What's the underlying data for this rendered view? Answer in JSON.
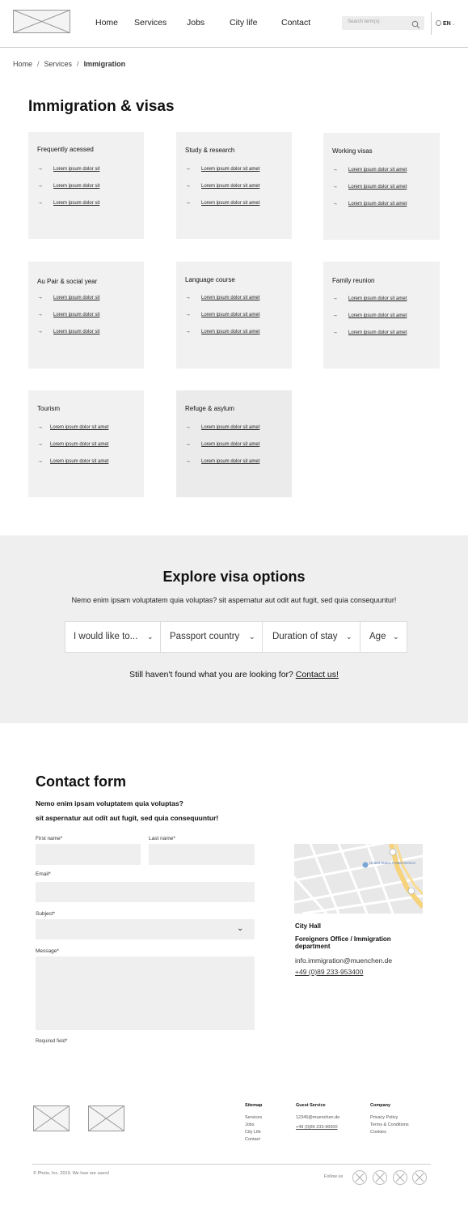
{
  "header": {
    "nav": [
      "Home",
      "Services",
      "Jobs",
      "City life",
      "Contact"
    ],
    "search_placeholder": "Search term(s)",
    "language": "EN"
  },
  "breadcrumb": {
    "home": "Home",
    "services": "Services",
    "current": "Immigration"
  },
  "page_title": "Immigration & visas",
  "cards": [
    {
      "title": "Frequently acessed",
      "links": [
        "Lorem ipsum dolor sit",
        "Lorem ipsum dolor sit",
        "Lorem ipsum dolor sit"
      ]
    },
    {
      "title": "Study & research",
      "links": [
        "Lorem ipsum dolor sit amet",
        "Lorem ipsum dolor sit amet",
        "Lorem ipsum dolor sit amet"
      ]
    },
    {
      "title": "Working visas",
      "links": [
        "Lorem ipsum dolor sit amet",
        "Lorem ipsum dolor sit amet",
        "Lorem ipsum dolor sit amet"
      ]
    },
    {
      "title": "Au Pair & social year",
      "links": [
        "Lorem ipsum dolor sit",
        "Lorem ipsum dolor sit",
        "Lorem ipsum dolor sit"
      ]
    },
    {
      "title": "Language course",
      "links": [
        "Lorem ipsum dolor sit amet",
        "Lorem ipsum dolor sit amet",
        "Lorem ipsum dolor sit amet"
      ]
    },
    {
      "title": "Family reunion",
      "links": [
        "Lorem ipsum dolor sit amet",
        "Lorem ipsum dolor sit amet",
        "Lorem ipsum dolor sit amet"
      ]
    },
    {
      "title": "Tourism",
      "links": [
        "Lorem ipsum dolor sit amet",
        "Lorem ipsum dolor sit amet",
        "Lorem ipsum dolor sit amet"
      ]
    },
    {
      "title": "Refuge & asylum",
      "links": [
        "Lorem ipsum dolor sit amet",
        "Lorem ipsum dolor sit amet",
        "Lorem ipsum dolor sit amet"
      ]
    }
  ],
  "explore": {
    "title": "Explore visa options",
    "subtitle": "Nemo enim ipsam voluptatem quia voluptas? sit aspernatur aut odit aut fugit, sed quia consequuntur!",
    "selects": [
      "I would like to...",
      "Passport country",
      "Duration of stay",
      "Age"
    ],
    "not_found_text": "Still haven't found what you are looking for?",
    "contact_link": "Contact us!"
  },
  "contact_form": {
    "title": "Contact form",
    "lead_1": "Nemo enim ipsam voluptatem quia voluptas?",
    "lead_2": "sit aspernatur aut odit aut fugit, sed quia consequuntur!",
    "first_name_label": "First name*",
    "last_name_label": "Last name*",
    "email_label": "Email*",
    "subject_label": "Subject*",
    "message_label": "Message*",
    "required_note": "Required field*"
  },
  "address": {
    "name": "City Hall",
    "office": "Foreigners Office / Immigration department",
    "email": "info.immigration@muenchen.de",
    "phone": "+49 (0)89 233-953400",
    "map_label": "United States Postal Service"
  },
  "footer": {
    "sitemap_title": "Sitemap",
    "sitemap": [
      "Services",
      "Jobs",
      "City Life",
      "Contact"
    ],
    "guest_title": "Guest Service",
    "guest_email": "12345@muenchen.de",
    "guest_phone": "+49 (0)89 233-96500",
    "company_title": "Company",
    "company": [
      "Privacy Policy",
      "Terms & Conditions",
      "Cookies"
    ],
    "copyright": "© Photo, Inc. 2019. We love our users!",
    "follow_us": "Follow us"
  },
  "colors": {
    "card_bg": "#f1f1f1",
    "band_bg": "#efefef",
    "field_bg": "#efefef",
    "map_road": "#f6d27a"
  }
}
